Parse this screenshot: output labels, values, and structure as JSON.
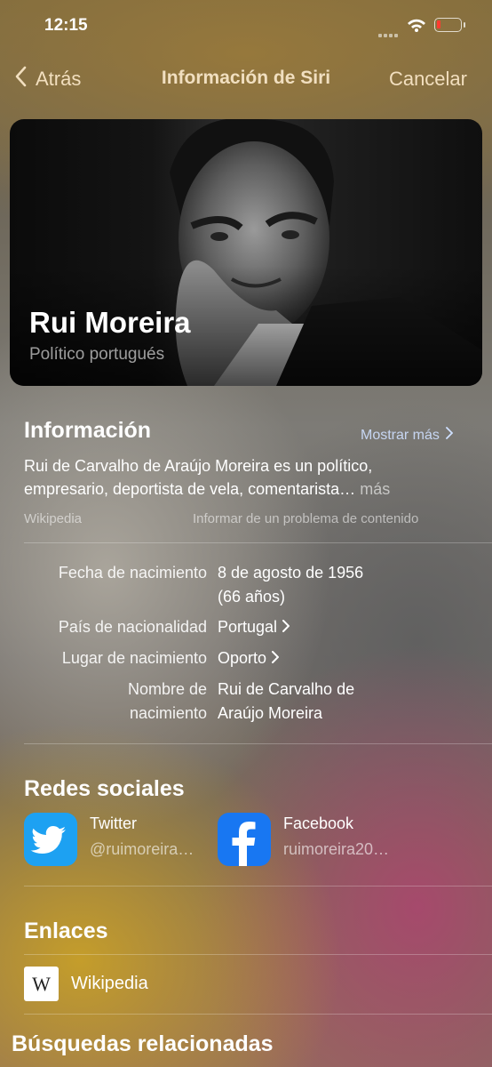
{
  "status_bar": {
    "time": "12:15"
  },
  "nav": {
    "back": "Atrás",
    "title": "Información de Siri",
    "cancel": "Cancelar"
  },
  "hero": {
    "name": "Rui Moreira",
    "subtitle": "Político portugués"
  },
  "info": {
    "title": "Información",
    "show_more": "Mostrar más",
    "text_line1": "Rui de Carvalho de Araújo Moreira es un político,",
    "text_line2": "empresario, deportista de vela, comentarista…",
    "more": "más",
    "source": "Wikipedia",
    "report": "Informar de un problema de contenido"
  },
  "facts": [
    {
      "label1": "Fecha de nacimiento",
      "label2": "",
      "value1": "8 de agosto de 1956",
      "value2": "(66 años)",
      "linked": false
    },
    {
      "label1": "País de nacionalidad",
      "label2": "",
      "value1": "Portugal",
      "value2": "",
      "linked": true
    },
    {
      "label1": "Lugar de nacimiento",
      "label2": "",
      "value1": "Oporto",
      "value2": "",
      "linked": true
    },
    {
      "label1": "Nombre de",
      "label2": "nacimiento",
      "value1": "Rui de Carvalho de",
      "value2": "Araújo Moreira",
      "linked": false
    }
  ],
  "social": {
    "title": "Redes sociales",
    "twitter": {
      "name": "Twitter",
      "handle": "@ruimoreira…",
      "color": "#1da1f2"
    },
    "facebook": {
      "name": "Facebook",
      "handle": "ruimoreira20…",
      "color": "#1877f2"
    }
  },
  "links": {
    "title": "Enlaces",
    "wikipedia": "Wikipedia",
    "wiki_glyph": "W"
  },
  "related": {
    "title": "Búsquedas relacionadas"
  }
}
